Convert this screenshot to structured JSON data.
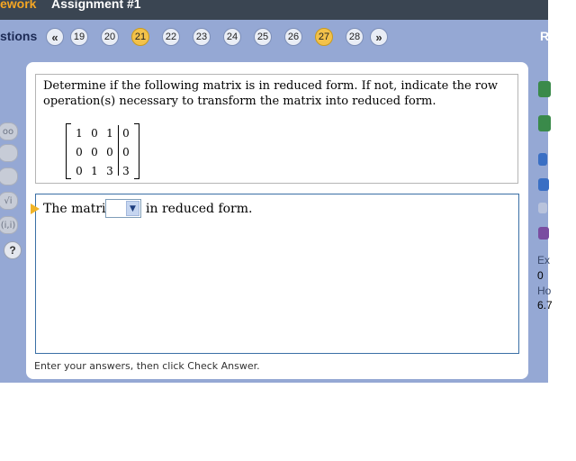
{
  "header": {
    "title_left": "ework",
    "title_right": "Assignment #1"
  },
  "nav": {
    "label": "stions",
    "prev": "«",
    "next": "»",
    "items": [
      {
        "label": "19",
        "done": false
      },
      {
        "label": "20",
        "done": false
      },
      {
        "label": "21",
        "done": true
      },
      {
        "label": "22",
        "done": false
      },
      {
        "label": "23",
        "done": false
      },
      {
        "label": "24",
        "done": false
      },
      {
        "label": "25",
        "done": false
      },
      {
        "label": "26",
        "done": false
      },
      {
        "label": "27",
        "done": true
      },
      {
        "label": "28",
        "done": false
      }
    ],
    "right_label": "R"
  },
  "question": {
    "text": "Determine if the following matrix is in reduced form. If not, indicate the row operation(s) necessary to transform the matrix into reduced form.",
    "matrix": [
      [
        "1",
        "0",
        "1",
        "0"
      ],
      [
        "0",
        "0",
        "0",
        "0"
      ],
      [
        "0",
        "1",
        "3",
        "3"
      ]
    ]
  },
  "answer": {
    "prefix": "The matrix",
    "selected": "",
    "suffix": "in reduced form."
  },
  "instructions": "Enter your answers, then click Check Answer.",
  "tools": [
    "oo",
    "",
    "",
    "√i",
    "(i,i)"
  ],
  "help": "?",
  "side": {
    "ex": "Ex",
    "val1": "0",
    "ho": "Ho",
    "val2": "6.7"
  },
  "colors": {
    "accent": "#f3c24a",
    "bg": "#95a8d4",
    "border": "#3a6fa5"
  }
}
